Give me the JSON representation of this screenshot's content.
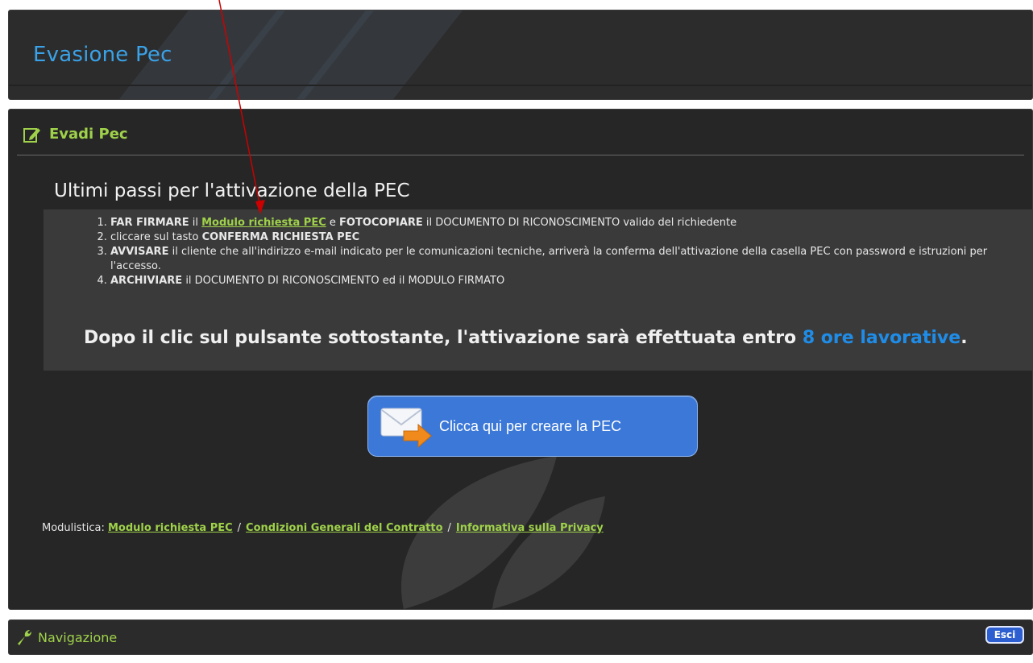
{
  "header": {
    "title": "Evasione Pec"
  },
  "section": {
    "title": "Evadi Pec",
    "icon": "edit-icon"
  },
  "main": {
    "heading": "Ultimi passi per l'attivazione della PEC",
    "steps": [
      {
        "bold1": "FAR FIRMARE",
        "t1": " il ",
        "link": "Modulo richiesta PEC",
        "t2": " e ",
        "bold2": "FOTOCOPIARE",
        "t3": " il DOCUMENTO DI RICONOSCIMENTO valido del richiedente"
      },
      {
        "t1": "cliccare sul tasto ",
        "bold1": "CONFERMA RICHIESTA PEC"
      },
      {
        "bold1": "AVVISARE",
        "t1": " il cliente che all'indirizzo e-mail indicato per le comunicazioni tecniche, arriverà la conferma dell'attivazione della casella PEC con password e istruzioni per l'accesso."
      },
      {
        "bold1": "ARCHIVIARE",
        "t1": " il DOCUMENTO DI RICONOSCIMENTO ed il MODULO FIRMATO"
      }
    ],
    "after_click": {
      "text": "Dopo il clic sul pulsante sottostante, l'attivazione sarà effettuata entro ",
      "highlight": "8 ore lavorative",
      "end": "."
    }
  },
  "cta": {
    "label": "Clicca qui per creare la PEC",
    "icon": "mail-arrow-icon"
  },
  "modulistica": {
    "label": "Modulistica: ",
    "links": [
      "Modulo richiesta PEC",
      "Condizioni Generali del Contratto",
      "Informativa sulla Privacy"
    ],
    "separator": "/"
  },
  "nav": {
    "label": "Navigazione",
    "icon": "wrench-icon",
    "exit_label": "Esci"
  },
  "colors": {
    "accent_blue": "#3aa2e8",
    "link_green": "#9fd14a",
    "button_blue": "#3b78d8",
    "annotation_red": "#cc0000"
  }
}
